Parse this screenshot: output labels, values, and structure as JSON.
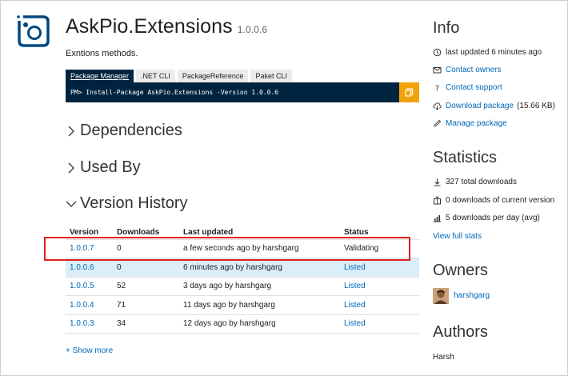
{
  "package": {
    "name": "AskPio.Extensions",
    "version": "1.0.0.6",
    "description": "Exntions methods."
  },
  "install": {
    "tabs": [
      {
        "label": "Package Manager",
        "active": true
      },
      {
        "label": ".NET CLI",
        "active": false
      },
      {
        "label": "PackageReference",
        "active": false
      },
      {
        "label": "Paket CLI",
        "active": false
      }
    ],
    "command": "PM> Install-Package AskPio.Extensions -Version 1.0.0.6",
    "copy_icon": "copy-icon"
  },
  "sections": {
    "dependencies": "Dependencies",
    "used_by": "Used By",
    "version_history": "Version History"
  },
  "version_table": {
    "headers": [
      "Version",
      "Downloads",
      "Last updated",
      "Status"
    ],
    "rows": [
      {
        "version": "1.0.0.7",
        "downloads": "0",
        "updated": "a few seconds ago by harshgarg",
        "status": "Validating",
        "highlight": false
      },
      {
        "version": "1.0.0.6",
        "downloads": "0",
        "updated": "6 minutes ago by harshgarg",
        "status": "Listed",
        "highlight": true
      },
      {
        "version": "1.0.0.5",
        "downloads": "52",
        "updated": "3 days ago by harshgarg",
        "status": "Listed",
        "highlight": false
      },
      {
        "version": "1.0.0.4",
        "downloads": "71",
        "updated": "11 days ago by harshgarg",
        "status": "Listed",
        "highlight": false
      },
      {
        "version": "1.0.0.3",
        "downloads": "34",
        "updated": "12 days ago by harshgarg",
        "status": "Listed",
        "highlight": false
      }
    ],
    "show_more": "+ Show more"
  },
  "info": {
    "heading": "Info",
    "last_updated": "last updated 6 minutes ago",
    "contact_owners": "Contact owners",
    "contact_support": "Contact support",
    "download_package": "Download package",
    "download_size": "(15.66 KB)",
    "manage_package": "Manage package"
  },
  "statistics": {
    "heading": "Statistics",
    "total_downloads": "327 total downloads",
    "current_version_downloads": "0 downloads of current version",
    "per_day": "5 downloads per day (avg)",
    "view_full": "View full stats"
  },
  "owners": {
    "heading": "Owners",
    "name": "harshgarg"
  },
  "authors": {
    "heading": "Authors",
    "name": "Harsh"
  },
  "colors": {
    "accent": "#0067b8",
    "command_bg": "#002440",
    "copy_button": "#f0a30a",
    "highlight_row": "#dbeefa",
    "annotation_box": "#e02020"
  }
}
